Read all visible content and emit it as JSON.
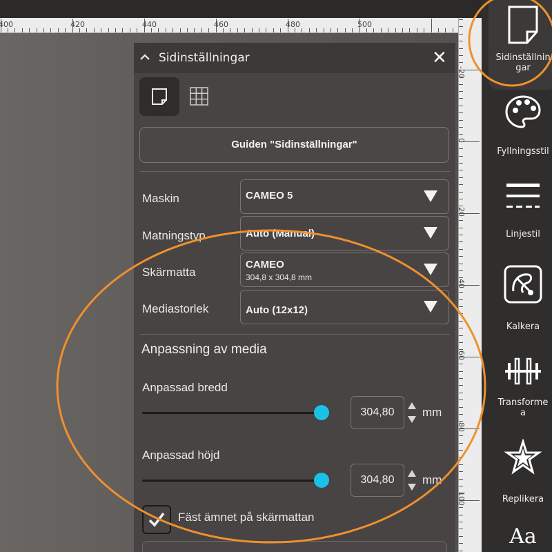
{
  "top_ruler": {
    "labels": [
      "400",
      "420",
      "440",
      "460",
      "480",
      "500"
    ]
  },
  "right_ruler": {
    "labels": [
      "-20",
      "0",
      "20",
      "40",
      "60",
      "80",
      "100"
    ]
  },
  "panel": {
    "title": "Sidinställningar",
    "close_glyph": "✕",
    "tabs": [
      {
        "name": "page",
        "icon": "page-icon",
        "active": true
      },
      {
        "name": "grid",
        "icon": "grid-icon",
        "active": false
      }
    ],
    "guide_button": "Guiden \"Sidinställningar\"",
    "machine": {
      "label": "Maskin",
      "value": "CAMEO 5"
    },
    "feed_type": {
      "label": "Matningstyp",
      "value": "Auto (Manual)"
    },
    "cutting_mat": {
      "label": "Skärmatta",
      "value": "CAMEO",
      "detail": "304,8 x 304,8 mm"
    },
    "media_size": {
      "label": "Mediastorlek",
      "value": "Auto (12x12)"
    },
    "section_title": "Anpassning av media",
    "custom_width": {
      "label": "Anpassad bredd",
      "value": "304,80",
      "unit": "mm",
      "slider_fraction": 1.0
    },
    "custom_height": {
      "label": "Anpassad höjd",
      "value": "304,80",
      "unit": "mm",
      "slider_fraction": 1.0
    },
    "pin_checkbox": {
      "label": "Fäst ämnet på skärmattan",
      "checked": true
    }
  },
  "toolbar": {
    "items": [
      {
        "label_line1": "Sidinställnin",
        "label_line2": "gar",
        "icon": "page-setup-icon",
        "active": true
      },
      {
        "label_line1": "Fyllningsstil",
        "label_line2": "",
        "icon": "palette-icon"
      },
      {
        "label_line1": "Linjestil",
        "label_line2": "",
        "icon": "line-style-icon"
      },
      {
        "label_line1": "Kalkera",
        "label_line2": "",
        "icon": "trace-icon"
      },
      {
        "label_line1": "Transforme",
        "label_line2": "a",
        "icon": "transform-icon"
      },
      {
        "label_line1": "Replikera",
        "label_line2": "",
        "icon": "replicate-icon"
      },
      {
        "label_line1": "",
        "label_line2": "",
        "glyph": "Aa",
        "icon": "text-style-icon"
      }
    ]
  },
  "colors": {
    "accent": "#19c3e8",
    "annotation": "#f0902e",
    "panel_bg": "#474443",
    "header_bg": "#3c3a39"
  }
}
